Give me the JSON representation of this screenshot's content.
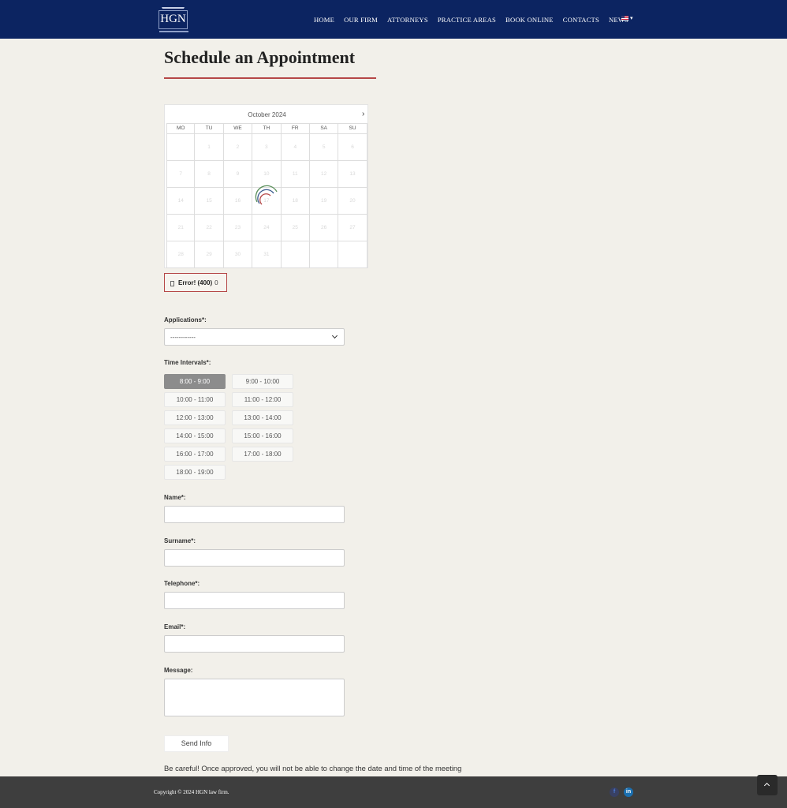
{
  "header": {
    "logo_text": "HGN",
    "nav": [
      "HOME",
      "OUR FIRM",
      "ATTORNEYS",
      "PRACTICE AREAS",
      "BOOK ONLINE",
      "CONTACTS",
      "NEWS"
    ],
    "language_caret": "▾"
  },
  "page": {
    "title": "Schedule an Appointment"
  },
  "calendar": {
    "month": "October 2024",
    "next_arrow": "›",
    "weekdays": [
      "MO",
      "TU",
      "WE",
      "TH",
      "FR",
      "SA",
      "SU"
    ],
    "weeks": [
      [
        "",
        "1",
        "2",
        "3",
        "4",
        "5",
        "6"
      ],
      [
        "7",
        "8",
        "9",
        "10",
        "11",
        "12",
        "13"
      ],
      [
        "14",
        "15",
        "16",
        "17",
        "18",
        "19",
        "20"
      ],
      [
        "21",
        "22",
        "23",
        "24",
        "25",
        "26",
        "27"
      ],
      [
        "28",
        "29",
        "30",
        "31",
        "",
        "",
        ""
      ]
    ]
  },
  "error": {
    "text": "Error! (400)",
    "code": "0"
  },
  "form": {
    "applications_label": "Applications*:",
    "applications_value": "------------",
    "time_label": "Time Intervals*:",
    "time_slots": [
      "8:00 - 9:00",
      "9:00 - 10:00",
      "10:00 - 11:00",
      "11:00 - 12:00",
      "12:00 - 13:00",
      "13:00 - 14:00",
      "14:00 - 15:00",
      "15:00 - 16:00",
      "16:00 - 17:00",
      "17:00 - 18:00",
      "18:00 - 19:00"
    ],
    "active_slot": "8:00 - 9:00",
    "name_label": "Name*:",
    "surname_label": "Surname*:",
    "telephone_label": "Telephone*:",
    "email_label": "Email*:",
    "message_label": "Message:",
    "send_label": "Send Info",
    "warning": "Be careful! Once approved, you will not be able to change the date and time of the meeting"
  },
  "footer": {
    "copyright": "Copyright © 2024 HGN law firm.",
    "social": [
      {
        "icon": "facebook-icon",
        "glyph": "f"
      },
      {
        "icon": "linkedin-icon",
        "glyph": "in"
      }
    ]
  },
  "colors": {
    "header_bg": "#0c2461",
    "accent": "#b54747",
    "footer_bg": "#3e3e3e",
    "active_slot": "#8c8c8c"
  }
}
